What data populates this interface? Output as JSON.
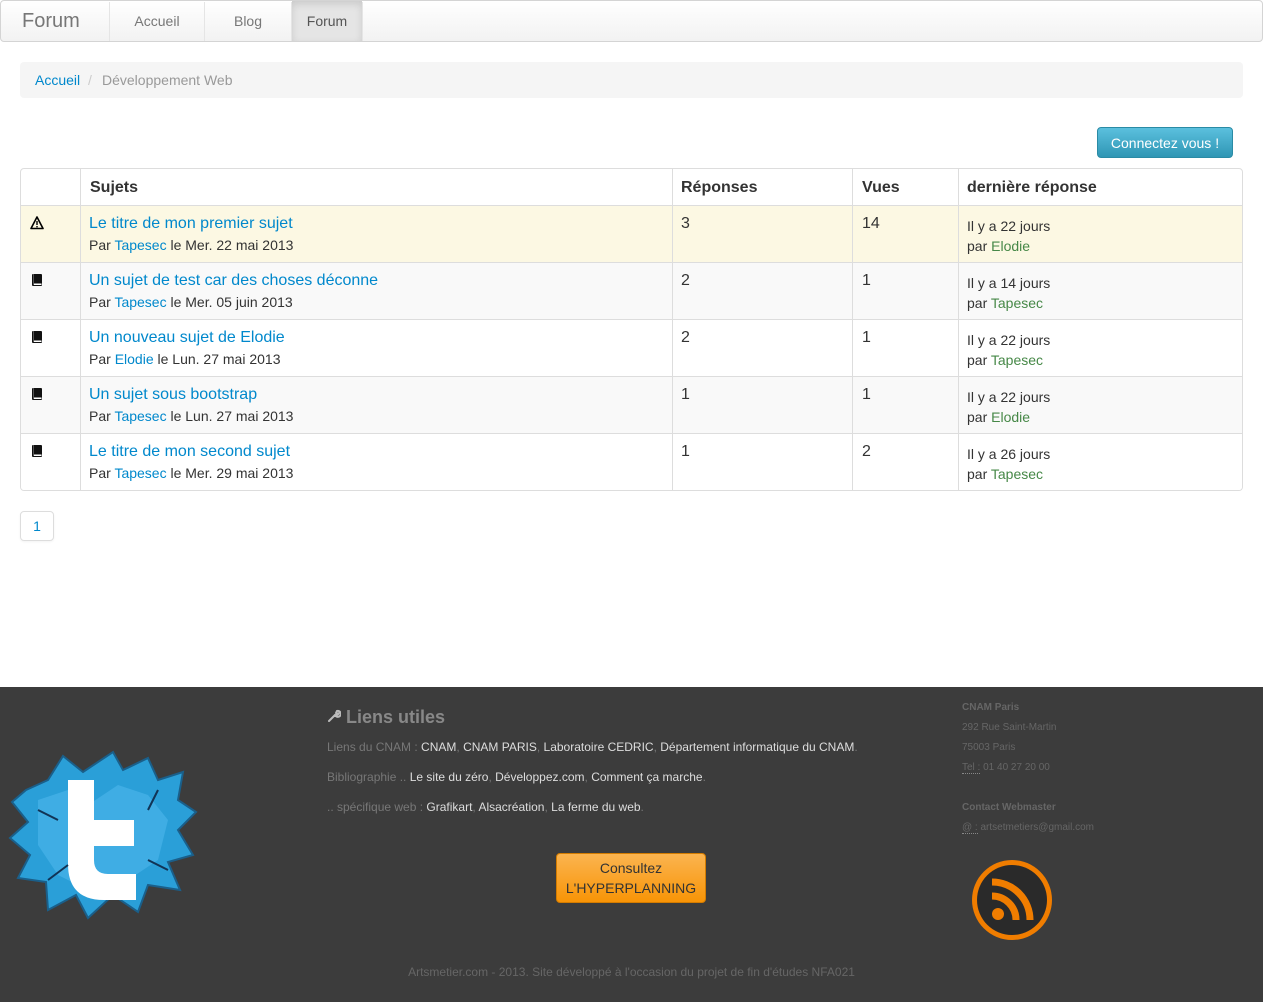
{
  "navbar": {
    "brand": "Forum",
    "items": [
      {
        "label": "Accueil"
      },
      {
        "label": "Blog"
      },
      {
        "label": "Forum",
        "active": true
      }
    ]
  },
  "breadcrumb": {
    "home": "Accueil",
    "divider": "/",
    "current": "Développement Web"
  },
  "login_button": "Connectez vous !",
  "table": {
    "headers": [
      "",
      "Sujets",
      "Réponses",
      "Vues",
      "dernière réponse"
    ],
    "rows": [
      {
        "icon": "warning-icon",
        "title": "Le titre de mon premier sujet",
        "by": "Par",
        "author": "Tapesec",
        "date": "le Mer. 22 mai 2013",
        "replies": "3",
        "views": "14",
        "last_time": "Il y a 22 jours",
        "last_by": "par",
        "last_user": "Elodie"
      },
      {
        "icon": "book-icon",
        "title": "Un sujet de test car des choses déconne",
        "by": "Par",
        "author": "Tapesec",
        "date": "le Mer. 05 juin 2013",
        "replies": "2",
        "views": "1",
        "last_time": "Il y a 14 jours",
        "last_by": "par",
        "last_user": "Tapesec"
      },
      {
        "icon": "book-icon",
        "title": "Un nouveau sujet de Elodie",
        "by": "Par",
        "author": "Elodie",
        "date": "le Lun. 27 mai 2013",
        "replies": "2",
        "views": "1",
        "last_time": "Il y a 22 jours",
        "last_by": "par",
        "last_user": "Tapesec"
      },
      {
        "icon": "book-icon",
        "title": "Un sujet sous bootstrap",
        "by": "Par",
        "author": "Tapesec",
        "date": "le Lun. 27 mai 2013",
        "replies": "1",
        "views": "1",
        "last_time": "Il y a 22 jours",
        "last_by": "par",
        "last_user": "Elodie"
      },
      {
        "icon": "book-icon",
        "title": "Le titre de mon second sujet",
        "by": "Par",
        "author": "Tapesec",
        "date": "le Mer. 29 mai 2013",
        "replies": "1",
        "views": "2",
        "last_time": "Il y a 26 jours",
        "last_by": "par",
        "last_user": "Tapesec"
      }
    ]
  },
  "pagination": {
    "pages": [
      "1"
    ]
  },
  "footer": {
    "links_title": "Liens utiles",
    "cnam_prefix": "Liens du CNAM :",
    "cnam_links": [
      "CNAM",
      "CNAM PARIS",
      "Laboratoire CEDRIC",
      "Département informatique du CNAM"
    ],
    "biblio_prefix": "Bibliographie ..",
    "biblio_links": [
      "Le site du zéro",
      "Développez.com",
      "Comment ça marche"
    ],
    "web_prefix": ".. spécifique web :",
    "web_links": [
      "Grafikart",
      "Alsacréation",
      "La ferme du web"
    ],
    "hyper_button_line1": "Consultez",
    "hyper_button_line2": "L'HYPERPLANNING",
    "contact": {
      "org": "CNAM Paris",
      "street": "292 Rue Saint-Martin",
      "city": "75003 Paris",
      "tel_label": "Tel :",
      "tel": "01 40 27 20 00",
      "webmaster_title": "Contact Webmaster",
      "email_label": "@ :",
      "email": "artsetmetiers@gmail.com"
    },
    "copyright": "Artsmetier.com - 2013. Site développé à l'occasion du projet de fin d'études NFA021"
  },
  "colors": {
    "link": "#0088cc",
    "success": "#468847",
    "warning_row": "#fcf8e3",
    "footer_bg": "#3c3c3c",
    "info_button": "#2f96b4",
    "orange_button": "#f89406"
  }
}
